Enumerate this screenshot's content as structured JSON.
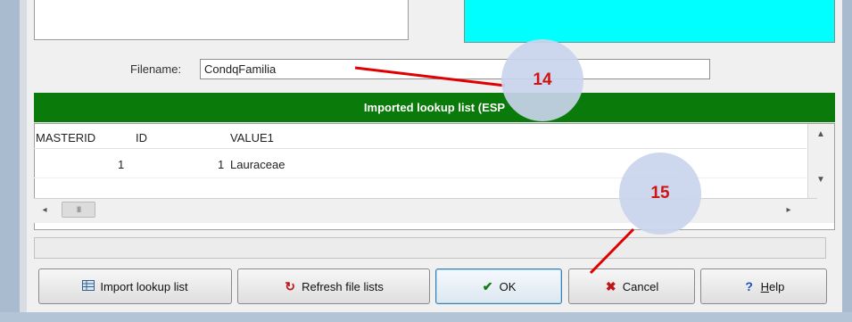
{
  "top_area": {},
  "filename": {
    "label": "Filename:",
    "value": "CondqFamilia"
  },
  "imported_list": {
    "header": "Imported lookup list (ESP",
    "columns": [
      "MASTERID",
      "ID",
      "VALUE1"
    ],
    "rows": [
      {
        "masterid": "1",
        "id": "1",
        "value1": "Lauraceae"
      }
    ]
  },
  "scrollbar": {
    "thumb_glyph": "III"
  },
  "buttons": {
    "import": "Import lookup list",
    "refresh": "Refresh file lists",
    "ok": "OK",
    "cancel": "Cancel",
    "help": "Help"
  },
  "annotations": [
    {
      "label": "14"
    },
    {
      "label": "15"
    }
  ],
  "colors": {
    "header_bar": "#0a7a0a",
    "cyan_panel": "#00ffff",
    "annotation_text": "#d00000",
    "annotation_line": "#e00000",
    "annotation_circle": "#c9d4ec"
  },
  "icons": {
    "import": "table-icon",
    "refresh": "refresh-icon",
    "ok": "checkmark-icon",
    "cancel": "x-icon",
    "help": "question-mark-icon"
  }
}
